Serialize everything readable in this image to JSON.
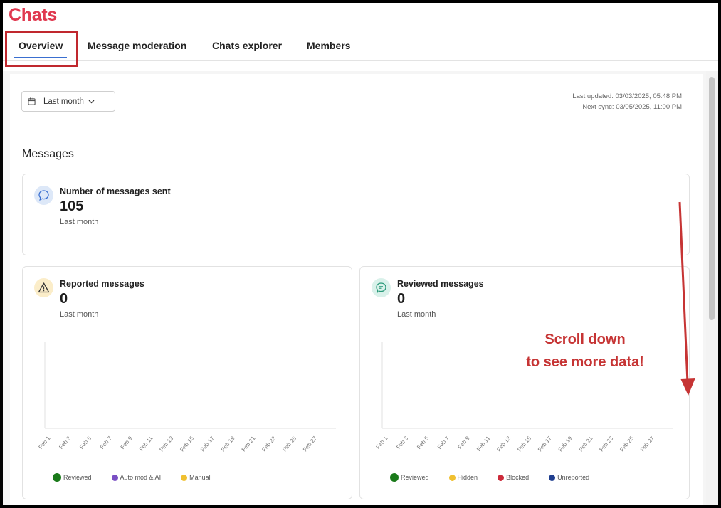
{
  "app": {
    "title": "Chats"
  },
  "tabs": [
    {
      "label": "Overview",
      "active": true
    },
    {
      "label": "Message moderation",
      "active": false
    },
    {
      "label": "Chats explorer",
      "active": false
    },
    {
      "label": "Members",
      "active": false
    }
  ],
  "filter": {
    "label": "Last month"
  },
  "sync": {
    "last_updated": "Last updated: 03/03/2025, 05:48 PM",
    "next_sync": "Next sync: 03/05/2025, 11:00 PM"
  },
  "section": {
    "title": "Messages"
  },
  "cards": {
    "sent": {
      "title": "Number of messages sent",
      "value": "105",
      "period": "Last month",
      "icon": "chat-bubble-icon"
    },
    "reported": {
      "title": "Reported messages",
      "value": "0",
      "period": "Last month",
      "icon": "warning-icon"
    },
    "reviewed": {
      "title": "Reviewed messages",
      "value": "0",
      "period": "Last month",
      "icon": "message-review-icon"
    }
  },
  "x_ticks": [
    "Feb 1",
    "Feb 3",
    "Feb 5",
    "Feb 7",
    "Feb 9",
    "Feb 11",
    "Feb 13",
    "Feb 15",
    "Feb 17",
    "Feb 19",
    "Feb 21",
    "Feb 23",
    "Feb 25",
    "Feb 27"
  ],
  "legends": {
    "reported": [
      {
        "label": "Reviewed",
        "color": "#1a7a1a"
      },
      {
        "label": "Auto mod & AI",
        "color": "#7a4fc4"
      },
      {
        "label": "Manual",
        "color": "#f0c030"
      }
    ],
    "reviewed": [
      {
        "label": "Reviewed",
        "color": "#1a7a1a"
      },
      {
        "label": "Hidden",
        "color": "#f0c030"
      },
      {
        "label": "Blocked",
        "color": "#cc2a3a"
      },
      {
        "label": "Unreported",
        "color": "#1f3e8f"
      }
    ]
  },
  "annotation": {
    "line1": "Scroll down",
    "line2": "to see more data!",
    "color": "#c63434"
  },
  "chart_data": [
    {
      "type": "bar",
      "categories": [
        "Feb 1",
        "Feb 3",
        "Feb 5",
        "Feb 7",
        "Feb 9",
        "Feb 11",
        "Feb 13",
        "Feb 15",
        "Feb 17",
        "Feb 19",
        "Feb 21",
        "Feb 23",
        "Feb 25",
        "Feb 27"
      ],
      "series": [
        {
          "name": "Reviewed",
          "values": [
            0,
            0,
            0,
            0,
            0,
            0,
            0,
            0,
            0,
            0,
            0,
            0,
            0,
            0
          ]
        },
        {
          "name": "Auto mod & AI",
          "values": [
            0,
            0,
            0,
            0,
            0,
            0,
            0,
            0,
            0,
            0,
            0,
            0,
            0,
            0
          ]
        },
        {
          "name": "Manual",
          "values": [
            0,
            0,
            0,
            0,
            0,
            0,
            0,
            0,
            0,
            0,
            0,
            0,
            0,
            0
          ]
        }
      ],
      "legend": "bottom"
    },
    {
      "type": "bar",
      "categories": [
        "Feb 1",
        "Feb 3",
        "Feb 5",
        "Feb 7",
        "Feb 9",
        "Feb 11",
        "Feb 13",
        "Feb 15",
        "Feb 17",
        "Feb 19",
        "Feb 21",
        "Feb 23",
        "Feb 25",
        "Feb 27"
      ],
      "series": [
        {
          "name": "Reviewed",
          "values": [
            0,
            0,
            0,
            0,
            0,
            0,
            0,
            0,
            0,
            0,
            0,
            0,
            0,
            0
          ]
        },
        {
          "name": "Hidden",
          "values": [
            0,
            0,
            0,
            0,
            0,
            0,
            0,
            0,
            0,
            0,
            0,
            0,
            0,
            0
          ]
        },
        {
          "name": "Blocked",
          "values": [
            0,
            0,
            0,
            0,
            0,
            0,
            0,
            0,
            0,
            0,
            0,
            0,
            0,
            0
          ]
        },
        {
          "name": "Unreported",
          "values": [
            0,
            0,
            0,
            0,
            0,
            0,
            0,
            0,
            0,
            0,
            0,
            0,
            0,
            0
          ]
        }
      ],
      "legend": "bottom"
    }
  ]
}
